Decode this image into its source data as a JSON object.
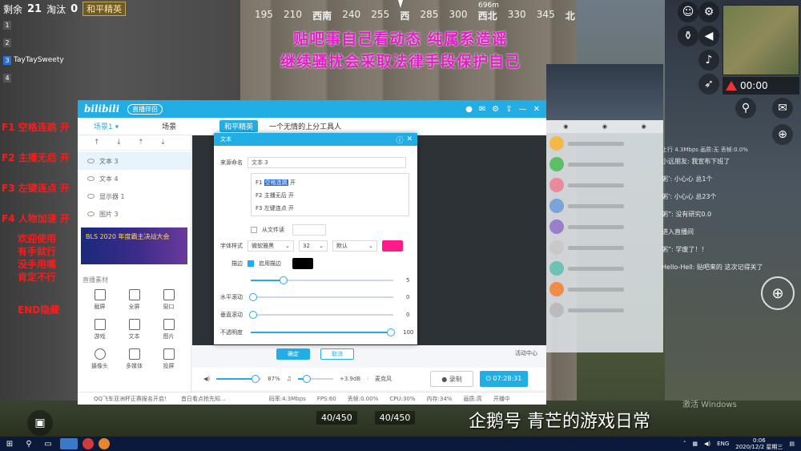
{
  "hud": {
    "remaining_label": "剩余",
    "remaining": "21",
    "eliminated_label": "淘汰",
    "eliminated": "0",
    "badge": "和平精英",
    "team": [
      {
        "idx": "1",
        "name": ""
      },
      {
        "idx": "2",
        "name": ""
      },
      {
        "idx": "3",
        "name": "TayTaySweety"
      },
      {
        "idx": "4",
        "name": ""
      }
    ],
    "compass": [
      "195",
      "210",
      "西南",
      "240",
      "255",
      "西",
      "285",
      "300",
      "西北",
      "330",
      "345",
      "北"
    ],
    "compass_distance": "696m",
    "timer": "00:00",
    "ammo_left": "40/450",
    "ammo_right": "40/450"
  },
  "notice": {
    "line1": "贴吧事自己看动态 纯属系造谣",
    "line2": "继续骚扰会采取法律手段保护自己"
  },
  "hotkeys": [
    "F1 空格连跳 开",
    "F2 主播无后 开",
    "F3 左键连点 开",
    "F4 人物加速 开"
  ],
  "welcome": [
    "欢迎使用",
    "有手就行",
    "没手用嘴",
    "肯定不行"
  ],
  "end_hide": "END隐藏",
  "bili": {
    "logo": "bilibili",
    "pill": "直播伴侣",
    "tabs": [
      "场景1 ▾",
      "场景",
      "和平精英",
      "一个无情的上分工具人"
    ],
    "sources": [
      "文本 3",
      "文本 4",
      "显示器 1",
      "图片 3"
    ],
    "banner": "BLS 2020 年度霸主决战大会",
    "material_title": "直播素材",
    "materials": [
      "截屏",
      "全屏",
      "窗口",
      "游戏",
      "文本",
      "图片",
      "摄像头",
      "多媒体",
      "投屏"
    ],
    "controls": {
      "volume": "87%",
      "mic": "+3.9dB",
      "mic_label": "麦克风",
      "record": "● 录制",
      "live": "⏻ 07:28:31",
      "activity": "活动中心"
    },
    "status": [
      "QQ飞车亚洲杯正赛报名开启！",
      "首日看点抢先知...",
      "码率:4.3Mbps",
      "FPS:60",
      "丢帧:0.00%",
      "CPU:30%",
      "内存:34%",
      "画质:高",
      "开播中"
    ],
    "volume_fill": 0.87
  },
  "dialog": {
    "title": "文本",
    "name_label": "来源命名",
    "name_value": "文本 3",
    "content_lines": [
      {
        "key": "F1",
        "text": "空格连跳",
        "state": "开"
      },
      {
        "key": "F2",
        "text": "主播无后",
        "state": "开"
      },
      {
        "key": "F3",
        "text": "左键连点",
        "state": "开"
      }
    ],
    "from_file": "从文件读",
    "font_label": "字体样式",
    "font_family": "微软雅黑",
    "font_size": "32",
    "font_style": "默认",
    "text_color": "#ff1a8c",
    "stroke_label": "描边",
    "stroke_enable": "启用描边",
    "stroke_color": "#000000",
    "stroke_width": "5",
    "hscroll_label": "水平滚动",
    "hscroll": "0",
    "vscroll_label": "垂直滚动",
    "vscroll": "0",
    "opacity_label": "不透明度",
    "opacity": "100",
    "ok": "确定",
    "cancel": "取消"
  },
  "chat": [
    "小远朋友: 我宣布下班了",
    "粥’: 小心心 总1个",
    "粥’: 小心心 总23个",
    "粥”: 没有研究0.0",
    "进入直播间",
    "粥”: 学废了！！",
    "Hello-Hell: 贴吧来的 这次记得关了"
  ],
  "chat_stats": "上行 4.3Mbps   画质:无   丢帧:0.0%",
  "watermark": "企鹅号 青芒的游戏日常",
  "activate_windows": "激活 Windows",
  "taskbar": {
    "lang": "ENG",
    "time": "0:06",
    "date": "2020/12/2 星期三"
  }
}
